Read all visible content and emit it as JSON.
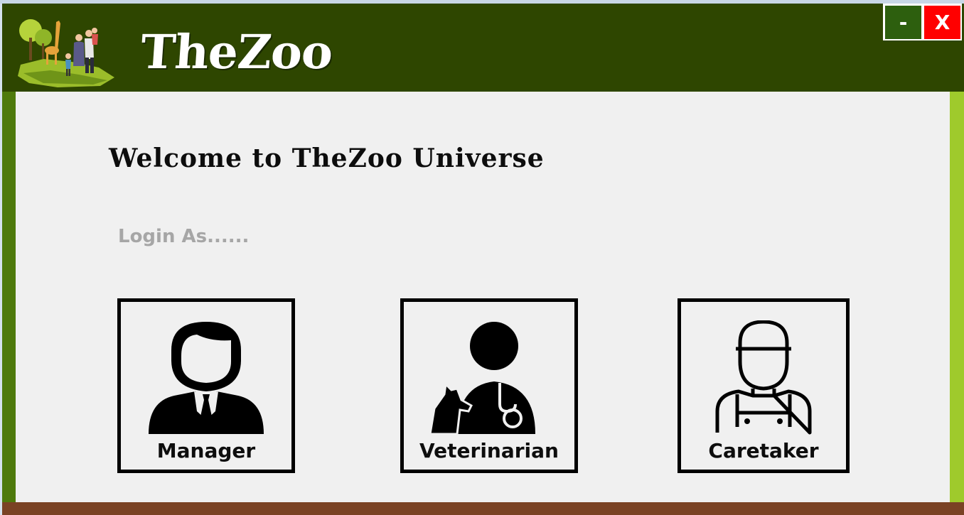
{
  "app": {
    "title": "TheZoo"
  },
  "window_controls": {
    "minimize_label": "-",
    "close_label": "X"
  },
  "main": {
    "welcome_text": "Welcome to TheZoo Universe",
    "login_prompt": "Login As......",
    "roles": [
      {
        "label": "Manager",
        "icon": "manager-icon"
      },
      {
        "label": "Veterinarian",
        "icon": "veterinarian-icon"
      },
      {
        "label": "Caretaker",
        "icon": "caretaker-icon"
      }
    ]
  },
  "colors": {
    "header_bg": "#2e4600",
    "left_stripe": "#4e7a0c",
    "right_stripe": "#9fca2c",
    "bottom_bar": "#7a4224",
    "minimize_btn": "#2d5f0e",
    "close_btn": "#ff0000",
    "content_bg": "#f0f0f0",
    "login_prompt_text": "#a6a6a6"
  }
}
